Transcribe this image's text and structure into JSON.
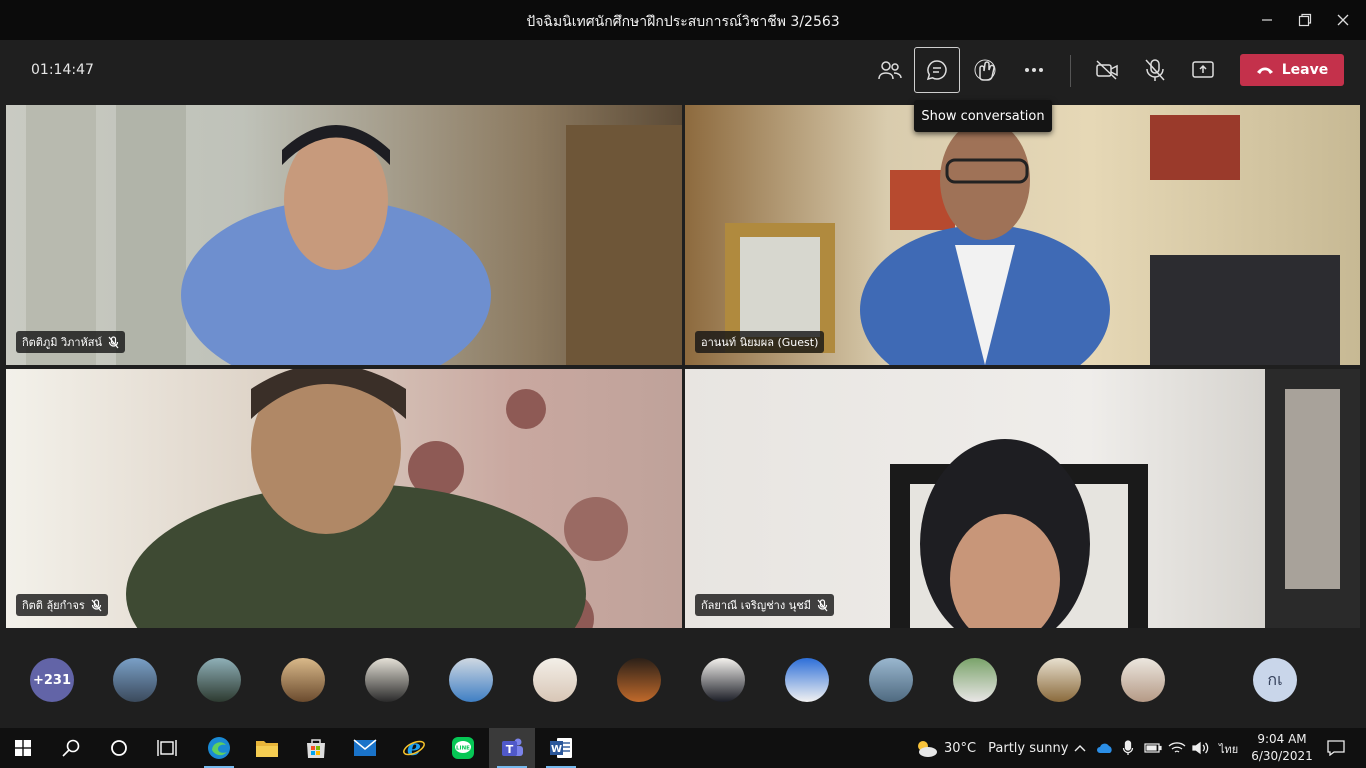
{
  "window": {
    "title": "ปัจฉิมนิเทศนักศึกษาฝึกประสบการณ์วิชาชีพ 3/2563",
    "minimize_icon": "minimize-icon",
    "maximize_icon": "maximize-icon",
    "close_icon": "close-icon"
  },
  "toolbar": {
    "timer": "01:14:47",
    "buttons": [
      "participants-icon",
      "chat-icon",
      "reactions-icon",
      "more-icon",
      "camera-off-icon",
      "mic-off-icon",
      "share-icon"
    ],
    "leave_label": "Leave",
    "tooltip": "Show conversation"
  },
  "video_tiles": [
    {
      "name": "กิตติภูมิ วิภาหัสน์",
      "muted": true
    },
    {
      "name": "อานนท์ นิยมผล (Guest)",
      "muted": true
    },
    {
      "name": "กิตติ ลุ้ยกำจร",
      "muted": true
    },
    {
      "name": "กัลยาณี เจริญช่าง นุชมี",
      "muted": true
    }
  ],
  "participants_strip": {
    "overflow_count": "+231",
    "last_initials": "กเ"
  },
  "taskbar": {
    "apps": [
      "windows-start-icon",
      "search-icon",
      "cortana-icon",
      "task-view-icon",
      "edge-icon",
      "file-explorer-icon",
      "store-icon",
      "mail-icon",
      "ie-icon",
      "line-icon",
      "teams-icon",
      "word-icon"
    ],
    "weather_temp": "30°C",
    "weather_desc": "Partly sunny",
    "lang": "ไทย",
    "time": "9:04 AM",
    "date": "6/30/2021",
    "colors": {
      "accent": "#6264a7",
      "leave": "#c4314b",
      "taskbar_indicator": "#76b9ed"
    }
  }
}
